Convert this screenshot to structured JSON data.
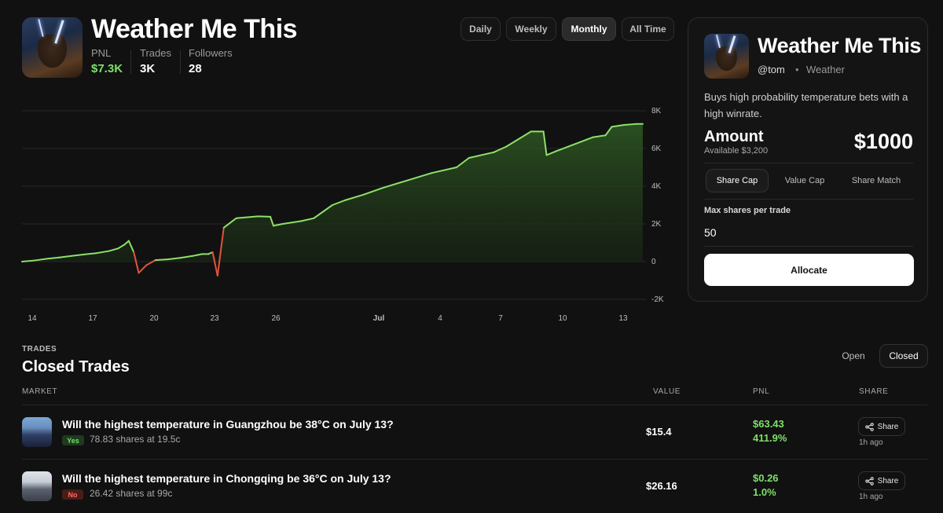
{
  "header": {
    "title": "Weather Me This",
    "stats": [
      {
        "label": "PNL",
        "value": "$7.3K",
        "color": "#7ee06a"
      },
      {
        "label": "Trades",
        "value": "3K",
        "color": "#ffffff"
      },
      {
        "label": "Followers",
        "value": "28",
        "color": "#ffffff"
      }
    ]
  },
  "periods": [
    "Daily",
    "Weekly",
    "Monthly",
    "All Time"
  ],
  "active_period": "Monthly",
  "chart_data": {
    "type": "area",
    "y_ticks": [
      "8K",
      "6K",
      "4K",
      "2K",
      "0",
      "-2K"
    ],
    "x_ticks": [
      "14",
      "17",
      "20",
      "23",
      "26",
      "Jul",
      "4",
      "7",
      "10",
      "13"
    ],
    "ylim": [
      -2000,
      8000
    ],
    "positive_color": "#8de06a",
    "negative_color": "#e2533c",
    "points": [
      [
        0,
        0
      ],
      [
        0.02,
        60
      ],
      [
        0.04,
        150
      ],
      [
        0.06,
        220
      ],
      [
        0.08,
        300
      ],
      [
        0.1,
        380
      ],
      [
        0.12,
        450
      ],
      [
        0.14,
        560
      ],
      [
        0.155,
        700
      ],
      [
        0.165,
        900
      ],
      [
        0.172,
        1100
      ],
      [
        0.18,
        500
      ],
      [
        0.188,
        -600
      ],
      [
        0.2,
        -200
      ],
      [
        0.215,
        80
      ],
      [
        0.235,
        120
      ],
      [
        0.255,
        200
      ],
      [
        0.275,
        300
      ],
      [
        0.29,
        400
      ],
      [
        0.3,
        400
      ],
      [
        0.307,
        500
      ],
      [
        0.315,
        -750
      ],
      [
        0.325,
        1800
      ],
      [
        0.345,
        2300
      ],
      [
        0.38,
        2400
      ],
      [
        0.4,
        2380
      ],
      [
        0.405,
        1900
      ],
      [
        0.42,
        2000
      ],
      [
        0.45,
        2150
      ],
      [
        0.47,
        2300
      ],
      [
        0.5,
        3000
      ],
      [
        0.52,
        3250
      ],
      [
        0.55,
        3550
      ],
      [
        0.58,
        3900
      ],
      [
        0.62,
        4300
      ],
      [
        0.66,
        4700
      ],
      [
        0.7,
        5000
      ],
      [
        0.72,
        5500
      ],
      [
        0.76,
        5800
      ],
      [
        0.78,
        6100
      ],
      [
        0.8,
        6500
      ],
      [
        0.82,
        6900
      ],
      [
        0.84,
        6900
      ],
      [
        0.845,
        5650
      ],
      [
        0.86,
        5850
      ],
      [
        0.88,
        6100
      ],
      [
        0.9,
        6350
      ],
      [
        0.92,
        6600
      ],
      [
        0.94,
        6700
      ],
      [
        0.95,
        7150
      ],
      [
        0.97,
        7250
      ],
      [
        0.99,
        7300
      ],
      [
        1,
        7300
      ]
    ]
  },
  "panel": {
    "title": "Weather Me This",
    "handle": "@tom",
    "dot": "•",
    "category": "Weather",
    "description": "Buys high probability temperature bets with a high winrate.",
    "amount_label": "Amount",
    "available": "Available $3,200",
    "amount_value": "$1000",
    "cap_tabs": [
      "Share Cap",
      "Value Cap",
      "Share Match"
    ],
    "active_cap": "Share Cap",
    "max_label": "Max shares per trade",
    "max_value": "50",
    "allocate_label": "Allocate"
  },
  "trades": {
    "eyebrow": "TRADES",
    "title": "Closed Trades",
    "filters": [
      "Open",
      "Closed"
    ],
    "active_filter": "Closed",
    "columns": [
      "MARKET",
      "VALUE",
      "PNL",
      "SHARE"
    ],
    "rows": [
      {
        "question": "Will the highest temperature in Guangzhou be 38°C on July 13?",
        "side": "Yes",
        "shares": "78.83 shares at 19.5c",
        "value": "$15.4",
        "pnl": "$63.43",
        "pnl_pct": "411.9%",
        "share_label": "Share",
        "time": "1h ago"
      },
      {
        "question": "Will the highest temperature in Chongqing be 36°C on July 13?",
        "side": "No",
        "shares": "26.42 shares at 99c",
        "value": "$26.16",
        "pnl": "$0.26",
        "pnl_pct": "1.0%",
        "share_label": "Share",
        "time": "1h ago"
      }
    ]
  }
}
